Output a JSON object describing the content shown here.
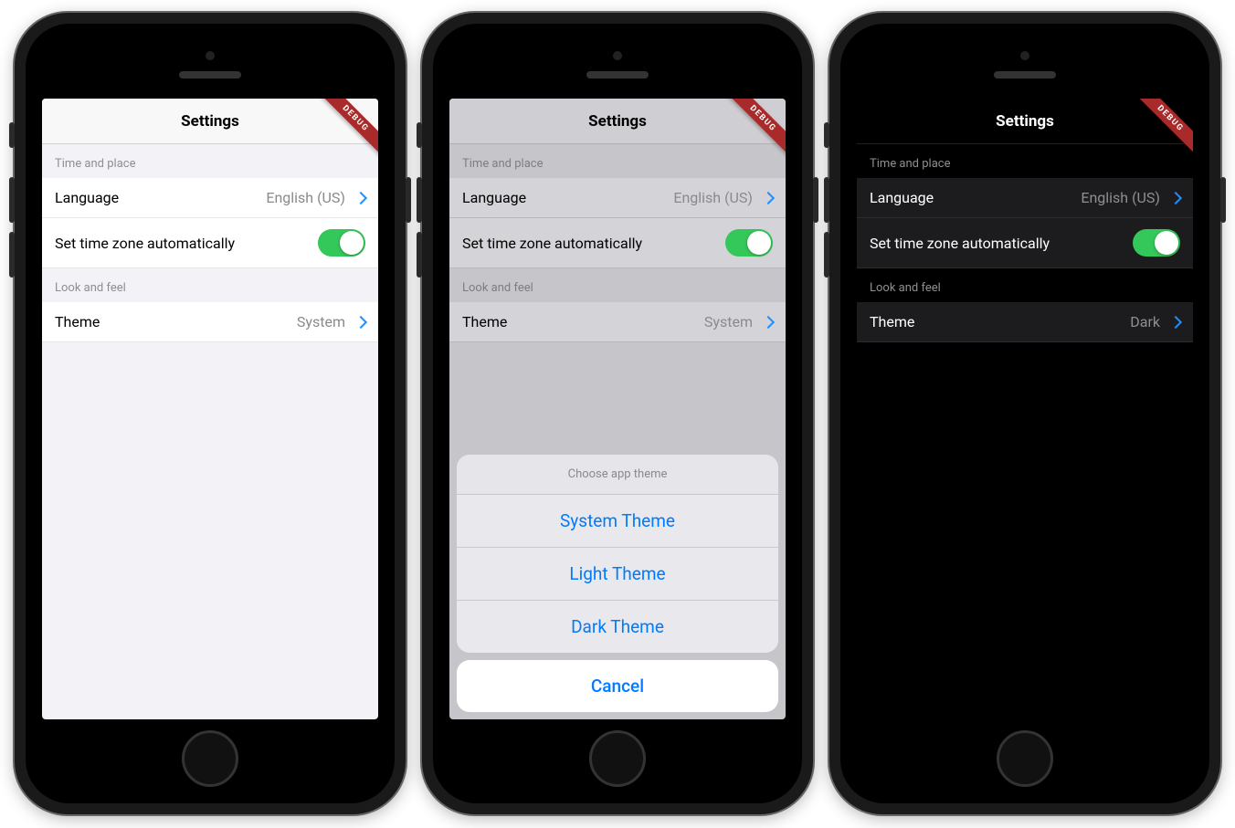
{
  "common": {
    "navbar_title": "Settings",
    "debug_ribbon": "DEBUG",
    "sections": {
      "time_place": "Time and place",
      "look_feel": "Look and feel"
    },
    "rows": {
      "language_label": "Language",
      "language_value": "English (US)",
      "timezone_label": "Set time zone automatically",
      "theme_label": "Theme"
    },
    "timezone_toggle_on": true
  },
  "screens": {
    "light": {
      "theme_value": "System"
    },
    "dimmed": {
      "theme_value": "System"
    },
    "dark": {
      "theme_value": "Dark"
    }
  },
  "action_sheet": {
    "title": "Choose app theme",
    "options": {
      "system": "System Theme",
      "light": "Light Theme",
      "dark": "Dark Theme"
    },
    "cancel": "Cancel"
  }
}
